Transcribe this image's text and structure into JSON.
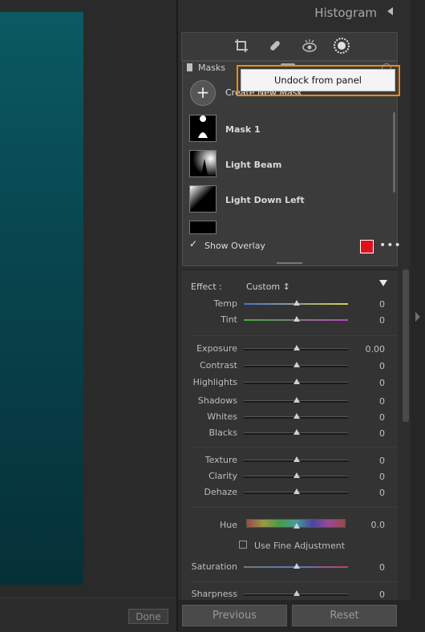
{
  "header": {
    "histogram_title": "Histogram"
  },
  "tools": [
    "crop-icon",
    "healing-icon",
    "redeye-icon",
    "masking-icon"
  ],
  "masks": {
    "title": "Masks",
    "create_label": "Create New Mask",
    "items": [
      {
        "label": "Mask 1"
      },
      {
        "label": "Light Beam"
      },
      {
        "label": "Light Down Left"
      }
    ],
    "show_overlay_label": "Show Overlay",
    "overlay_color": "#e0111c",
    "more_label": "•••"
  },
  "popup": {
    "undock_label": "Undock from panel"
  },
  "effect": {
    "label": "Effect :",
    "value": "Custom ↕"
  },
  "sliders": [
    {
      "label": "Temp",
      "value": "0"
    },
    {
      "label": "Tint",
      "value": "0"
    },
    {
      "label": "Exposure",
      "value": "0.00"
    },
    {
      "label": "Contrast",
      "value": "0"
    },
    {
      "label": "Highlights",
      "value": "0"
    },
    {
      "label": "Shadows",
      "value": "0"
    },
    {
      "label": "Whites",
      "value": "0"
    },
    {
      "label": "Blacks",
      "value": "0"
    },
    {
      "label": "Texture",
      "value": "0"
    },
    {
      "label": "Clarity",
      "value": "0"
    },
    {
      "label": "Dehaze",
      "value": "0"
    },
    {
      "label": "Hue",
      "value": "0.0"
    },
    {
      "label": "Saturation",
      "value": "0"
    },
    {
      "label": "Sharpness",
      "value": "0"
    }
  ],
  "fine_adjustment_label": "Use Fine Adjustment",
  "buttons": {
    "previous": "Previous",
    "reset": "Reset",
    "done": "Done"
  }
}
